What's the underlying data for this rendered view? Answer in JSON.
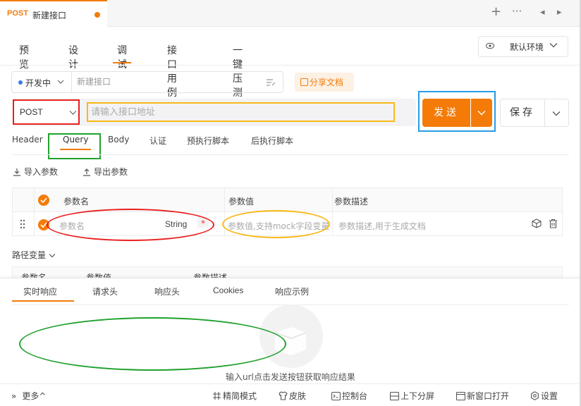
{
  "doc_tab": {
    "method": "POST",
    "name": "新建接口"
  },
  "tabstrip_controls": {
    "add": "+",
    "more": "···",
    "prev": "◂",
    "next": "▸"
  },
  "sub_tabs": [
    "预览",
    "设计",
    "调试",
    "接口用例",
    "一键压测"
  ],
  "active_sub_tab": "调试",
  "environment": {
    "label": "默认环境",
    "icon": "eye-icon"
  },
  "status": {
    "label": "开发中",
    "color": "#3b7bea"
  },
  "name_input": {
    "placeholder": "新建接口"
  },
  "share_button": "分享文档",
  "method_select": "POST",
  "url_input": {
    "placeholder": "请输入接口地址",
    "value": ""
  },
  "send_button": "发送",
  "save_button": "保存",
  "request_tabs": [
    "Header",
    "Query",
    "Body",
    "认证",
    "预执行脚本",
    "后执行脚本"
  ],
  "active_request_tab": "Query",
  "tools": {
    "import": "导入参数",
    "export": "导出参数"
  },
  "params_table": {
    "columns": [
      "参数名",
      "参数值",
      "参数描述"
    ],
    "row": {
      "name_placeholder": "参数名",
      "type": "String",
      "required_mark": "*",
      "value_placeholder": "参数值,支持mock字段变量",
      "desc_placeholder": "参数描述,用于生成文档"
    }
  },
  "path_variables": {
    "label": "路径变量",
    "columns": [
      "参数名",
      "参数值",
      "参数描述"
    ]
  },
  "response_tabs": [
    "实时响应",
    "请求头",
    "响应头",
    "Cookies",
    "响应示例"
  ],
  "active_response_tab": "实时响应",
  "response_empty_text": "输入url点击发送按钮获取响应结果",
  "footer": {
    "more": "更多",
    "items": [
      "精简模式",
      "皮肤",
      "控制台",
      "上下分屏",
      "新窗口打开",
      "设置"
    ]
  },
  "colors": {
    "accent": "#f47b08",
    "annotation_red": "#e8201f",
    "annotation_yellow": "#f9b817",
    "annotation_blue": "#279ce6",
    "annotation_green": "#20a12e"
  }
}
